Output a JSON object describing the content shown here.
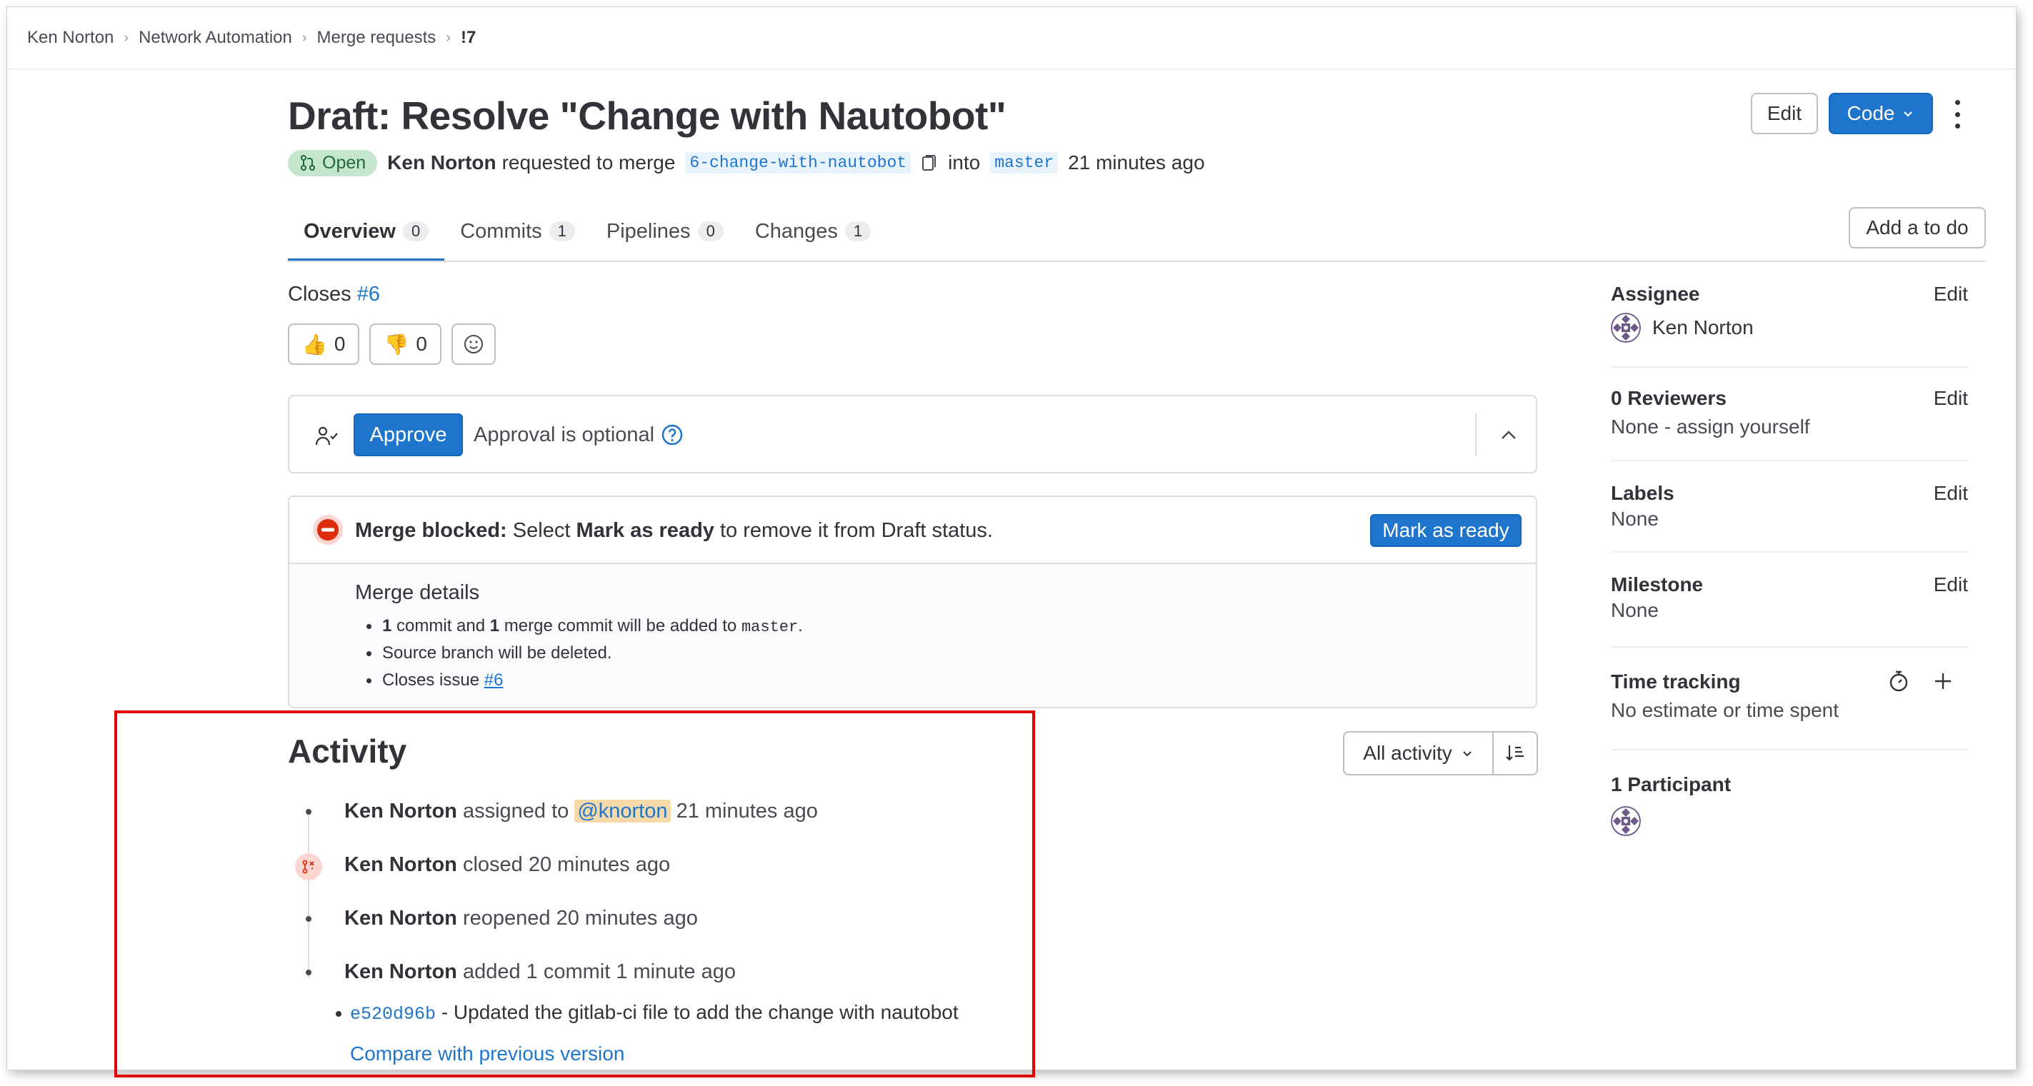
{
  "breadcrumb": [
    "Ken Norton",
    "Network Automation",
    "Merge requests",
    "!7"
  ],
  "title": "Draft: Resolve \"Change with Nautobot\"",
  "status": {
    "badge": "Open",
    "author": "Ken Norton",
    "requested_text": "requested to merge",
    "source_branch": "6-change-with-nautobot",
    "into_text": "into",
    "target_branch": "master",
    "time": "21 minutes ago"
  },
  "header_actions": {
    "edit": "Edit",
    "code": "Code"
  },
  "tabs": [
    {
      "label": "Overview",
      "count": "0"
    },
    {
      "label": "Commits",
      "count": "1"
    },
    {
      "label": "Pipelines",
      "count": "0"
    },
    {
      "label": "Changes",
      "count": "1"
    }
  ],
  "add_todo": "Add a to do",
  "closes": {
    "label": "Closes",
    "issue": "#6"
  },
  "reactions": {
    "thumbs_up": "0",
    "thumbs_down": "0"
  },
  "approval": {
    "button": "Approve",
    "text": "Approval is optional"
  },
  "merge": {
    "blocked_label": "Merge blocked:",
    "blocked_pre": "Select",
    "blocked_bold": "Mark as ready",
    "blocked_post": "to remove it from Draft status.",
    "ready_button": "Mark as ready",
    "details_title": "Merge details",
    "details": {
      "commit_count": "1",
      "commit_text": "commit and",
      "merge_count": "1",
      "merge_text": "merge commit will be added to",
      "branch": "master",
      "branch_after": ".",
      "source_deleted": "Source branch will be deleted.",
      "closes_text": "Closes issue",
      "closes_issue": "#6"
    }
  },
  "activity": {
    "title": "Activity",
    "filter": "All activity",
    "items": [
      {
        "author": "Ken Norton",
        "action": "assigned to",
        "mention": "@knorton",
        "time": "21 minutes ago"
      },
      {
        "author": "Ken Norton",
        "action": "closed",
        "time": "20 minutes ago"
      },
      {
        "author": "Ken Norton",
        "action": "reopened",
        "time": "20 minutes ago"
      },
      {
        "author": "Ken Norton",
        "action": "added 1 commit",
        "time": "1 minute ago"
      }
    ],
    "commit": {
      "sha": "e520d96b",
      "message": "- Updated the gitlab-ci file to add the change with nautobot"
    },
    "compare": "Compare with previous version"
  },
  "sidebar": {
    "assignee": {
      "label": "Assignee",
      "edit": "Edit",
      "value": "Ken Norton"
    },
    "reviewers": {
      "label": "0 Reviewers",
      "edit": "Edit",
      "value": "None - assign yourself"
    },
    "labels": {
      "label": "Labels",
      "edit": "Edit",
      "value": "None"
    },
    "milestone": {
      "label": "Milestone",
      "edit": "Edit",
      "value": "None"
    },
    "time_tracking": {
      "label": "Time tracking",
      "value": "No estimate or time spent"
    },
    "participants": {
      "label": "1 Participant"
    }
  },
  "colors": {
    "accent": "#1f75cb",
    "open_badge": "#c3e6cd",
    "blocked": "#dd2b0e",
    "highlight_box": "#e00000"
  }
}
